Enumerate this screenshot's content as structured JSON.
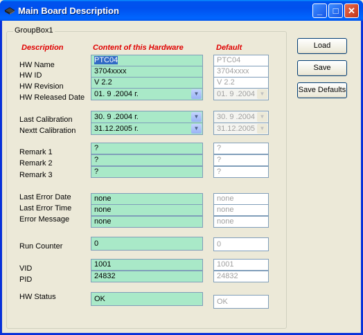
{
  "window": {
    "title": "Main Board Description"
  },
  "group": {
    "label": "GroupBox1"
  },
  "headers": {
    "description": "Description",
    "content": "Content of this Hardware",
    "default": "Default"
  },
  "labels": {
    "hw_name": "HW Name",
    "hw_id": "HW ID",
    "hw_revision": "HW Revision",
    "hw_released_date": "HW Released Date",
    "last_calibration": "Last Calibration",
    "next_calibration": "Nextt Calibration",
    "remark1": "Remark 1",
    "remark2": "Remark 2",
    "remark3": "Remark 3",
    "last_error_date": "Last Error Date",
    "last_error_time": "Last Error Time",
    "error_message": "Error Message",
    "run_counter": "Run Counter",
    "vid": "VID",
    "pid": "PID",
    "hw_status": "HW Status"
  },
  "content": {
    "hw_name": "PTC04",
    "hw_id": "3704xxxx",
    "hw_revision": "V 2.2",
    "hw_released_date": "01. 9 .2004 г.",
    "last_calibration": "30. 9 .2004 г.",
    "next_calibration": "31.12.2005 г.",
    "remark1": "?",
    "remark2": "?",
    "remark3": "?",
    "last_error_date": "none",
    "last_error_time": "none",
    "error_message": "none",
    "run_counter": "0",
    "vid": "1001",
    "pid": "24832",
    "hw_status": "OK"
  },
  "defaults": {
    "hw_name": "PTC04",
    "hw_id": "3704xxxx",
    "hw_revision": "V 2.2",
    "hw_released_date": "01. 9 .2004",
    "last_calibration": "30. 9 .2004",
    "next_calibration": "31.12.2005",
    "remark1": "?",
    "remark2": "?",
    "remark3": "?",
    "last_error_date": "none",
    "last_error_time": "none",
    "error_message": "none",
    "run_counter": "0",
    "vid": "1001",
    "pid": "24832",
    "hw_status": "OK"
  },
  "buttons": {
    "load": "Load",
    "save": "Save",
    "save_defaults": "Save Defaults"
  },
  "icons": {
    "app": "board-icon",
    "minimize": "minimize-icon",
    "maximize": "maximize-icon",
    "close": "close-icon",
    "dropdown": "chevron-down-icon"
  },
  "colors": {
    "field_bg": "#a9e9c8",
    "header_red": "#e00000",
    "titlebar": "#0053ee"
  }
}
